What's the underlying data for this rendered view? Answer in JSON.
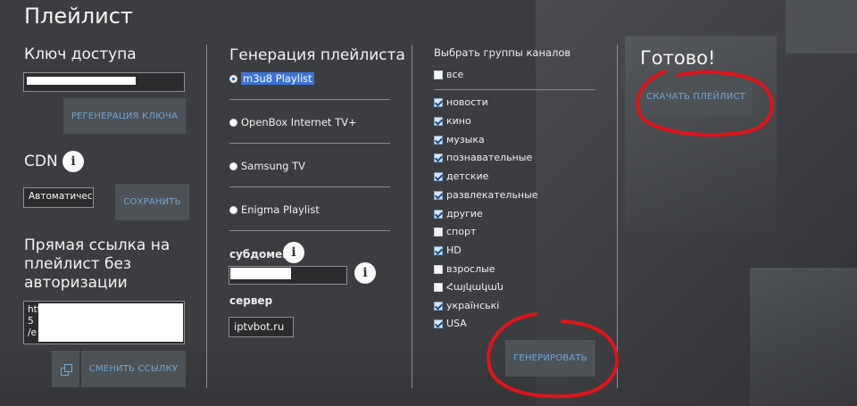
{
  "page": {
    "title": "Плейлист"
  },
  "col1": {
    "access_key_title": "Ключ доступа",
    "regen_button": "РЕГЕНЕРАЦИЯ КЛЮЧА",
    "cdn_title": "CDN",
    "cdn_select_value": "Автоматически",
    "save_button": "СОХРАНИТЬ",
    "direct_link_title": "Прямая ссылка на плейлист без авторизации",
    "direct_link_lines": [
      "http",
      "5",
      "/e"
    ],
    "change_link_button": "СМЕНИТЬ ССЫЛКУ"
  },
  "col2": {
    "title": "Генерация плейлиста",
    "options": [
      {
        "label": "m3u8 Playlist",
        "selected": true
      },
      {
        "label": "OpenBox Internet TV+",
        "selected": false
      },
      {
        "label": "Samsung TV",
        "selected": false
      },
      {
        "label": "Enigma Playlist",
        "selected": false
      }
    ],
    "subdomain_label": "субдомен",
    "server_label": "сервер",
    "server_value": "iptvbot.ru"
  },
  "col3": {
    "title": "Выбрать группы каналов",
    "all_label": "все",
    "groups": [
      {
        "label": "новости",
        "checked": true
      },
      {
        "label": "кино",
        "checked": true
      },
      {
        "label": "музыка",
        "checked": true
      },
      {
        "label": "познавательные",
        "checked": true
      },
      {
        "label": "детские",
        "checked": true
      },
      {
        "label": "развлекательные",
        "checked": true
      },
      {
        "label": "другие",
        "checked": true
      },
      {
        "label": "спорт",
        "checked": false
      },
      {
        "label": "HD",
        "checked": true
      },
      {
        "label": "взрослые",
        "checked": false
      },
      {
        "label": "Հայկական",
        "checked": false
      },
      {
        "label": "українські",
        "checked": true
      },
      {
        "label": "USA",
        "checked": true
      }
    ],
    "generate_button": "ГЕНЕРИРОВАТЬ"
  },
  "col4": {
    "title": "Готово!",
    "download_button": "СКАЧАТЬ ПЛЕЙЛИСТ"
  },
  "colors": {
    "accent_link": "#6fa6d6",
    "annotation": "#e0141b",
    "selection": "#3b73d6"
  }
}
